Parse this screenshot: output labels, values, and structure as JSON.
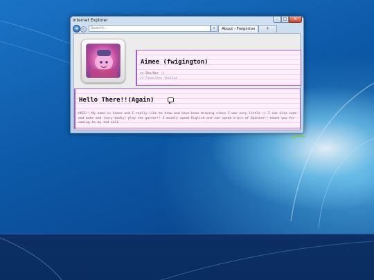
{
  "window": {
    "title": "Internet Explorer",
    "minimize": "–",
    "maximize": "□",
    "close": "✕"
  },
  "nav": {
    "back_glyph": "◂",
    "forward_glyph": "▸",
    "address_placeholder": "Search...",
    "search_glyph": "⌕",
    "tab_label": "About - Fwiginton",
    "new_tab_label": "+"
  },
  "profile": {
    "name": "Aimee (fwigington)",
    "pronouns_line": ">> She/Her :)",
    "favorites_link": ">> Favorites Section"
  },
  "bio": {
    "heading": "Hello There!!(Again)",
    "body": "HAII!! My name is Aimee and I really like to draw and have been drawing since I was very little :) I can also code and bake and (very badly) play the guitar!! I mainly speak English and can speak a bit of Spanish!! thank you for coming to my ted talk"
  },
  "colors": {
    "accent_border": "#a15cc7",
    "card_bg": "#fff0fb",
    "card_line": "#f4cfee"
  },
  "icons": [
    "back-icon",
    "forward-icon",
    "search-icon",
    "chat-bubble-icon",
    "profile-avatar"
  ]
}
